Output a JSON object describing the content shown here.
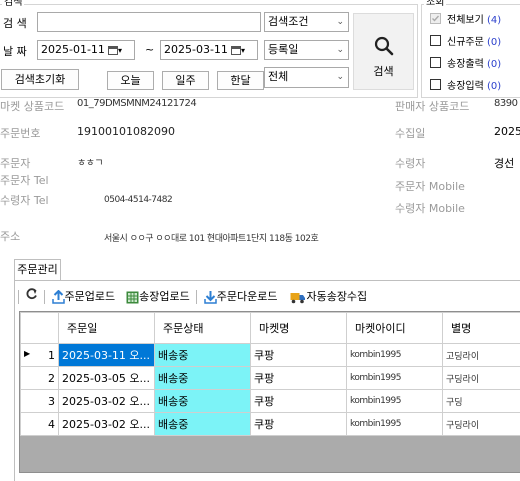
{
  "search_panel": {
    "group_label": "검색",
    "search_label": "검 색",
    "search_value": "",
    "search_condition": "검색조건",
    "date_label": "날 짜",
    "date_from": "2025-01-11",
    "date_tilde": "~",
    "date_to": "2025-03-11",
    "date_type": "등록일",
    "status_select": "전체",
    "reset_button": "검색초기화",
    "today_button": "오늘",
    "week_button": "일주",
    "month_button": "한달",
    "search_button": "검색"
  },
  "filters": {
    "title": "조회",
    "items": [
      {
        "label": "전체보기",
        "count": "(4)",
        "checked": true
      },
      {
        "label": "신규주문",
        "count": "(0)",
        "checked": false
      },
      {
        "label": "송장출력",
        "count": "(0)",
        "checked": false
      },
      {
        "label": "송장입력",
        "count": "(0)",
        "checked": false
      }
    ]
  },
  "details": {
    "product_code_label": "마켓 상품코드",
    "product_code_value": "01_79DMSMNM24121724",
    "order_no_label": "주문번호",
    "order_no_value": "19100101082090",
    "orderer_label": "주문자",
    "orderer_value": "ㅎㅎㄱ",
    "orderer_tel_label": "주문자 Tel",
    "receiver_tel_label": "수령자 Tel",
    "receiver_tel_value": "0504-4514-7482",
    "address_label": "주소",
    "address_value": "서울시 ㅇㅇ구 ㅇㅇ대로 101 현대아파트1단지 118동 102호",
    "seller_product_code_label": "판매자 상품코드",
    "seller_product_code_value": "8390",
    "collect_date_label": "수집일",
    "collect_date_value": "2025",
    "receiver_label": "수령자",
    "receiver_value": "경선",
    "orderer_mobile_label": "주문자 Mobile",
    "receiver_mobile_label": "수령자 Mobile"
  },
  "tab": {
    "label": "주문관리"
  },
  "toolbar": {
    "refresh_icon": "refresh-icon",
    "upload_order": "주문업로드",
    "upload_invoice": "송장업로드",
    "download_order": "주문다운로드",
    "auto_invoice": "자동송장수집"
  },
  "grid": {
    "columns": [
      "",
      "주문일",
      "주문상태",
      "마켓명",
      "마켓아이디",
      "별명"
    ],
    "rows": [
      {
        "no": "1",
        "date": "2025-03-11 오...",
        "status": "배송중",
        "market": "쿠팡",
        "market_id": "kombin1995",
        "alias": "고딩라이"
      },
      {
        "no": "2",
        "date": "2025-03-05 오...",
        "status": "배송중",
        "market": "쿠팡",
        "market_id": "kombin1995",
        "alias": "구딩라이"
      },
      {
        "no": "3",
        "date": "2025-03-02 오...",
        "status": "배송중",
        "market": "쿠팡",
        "market_id": "kombin1995",
        "alias": "구딩"
      },
      {
        "no": "4",
        "date": "2025-03-02 오...",
        "status": "배송중",
        "market": "쿠팡",
        "market_id": "kombin1995",
        "alias": "구딩라이"
      }
    ],
    "selected_color": "#0078d7",
    "status_color": "#7cf3f7"
  }
}
